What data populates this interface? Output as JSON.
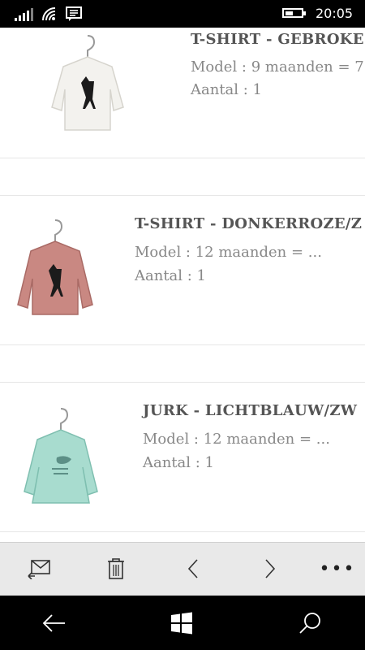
{
  "status": {
    "time": "20:05"
  },
  "items": [
    {
      "title": "T-SHIRT - GEBROKE",
      "model": "Model : 9 maanden = 7...",
      "qty": "Aantal : 1",
      "shirt_color": "#f3f2ee",
      "print": "deer"
    },
    {
      "title": "T-SHIRT - DONKERROZE/Z",
      "model": "Model : 12 maanden = ...",
      "qty": "Aantal : 1",
      "shirt_color": "#c98882",
      "print": "deer"
    },
    {
      "title": "JURK - LICHTBLAUW/ZW",
      "model": "Model : 12 maanden = ...",
      "qty": "Aantal : 1",
      "shirt_color": "#a8dccf",
      "print": "bird"
    }
  ],
  "appbar": {
    "icons": [
      "reply-mail-icon",
      "trash-icon",
      "chevron-left-icon",
      "chevron-right-icon"
    ],
    "more": "•••"
  },
  "navbar": {
    "icons": [
      "back-arrow-icon",
      "windows-logo-icon",
      "search-icon"
    ]
  },
  "colors": {
    "statusbar": "#000000",
    "appbar": "#e9e9e9",
    "navbar": "#000000",
    "title": "#555555",
    "meta": "#888888"
  }
}
